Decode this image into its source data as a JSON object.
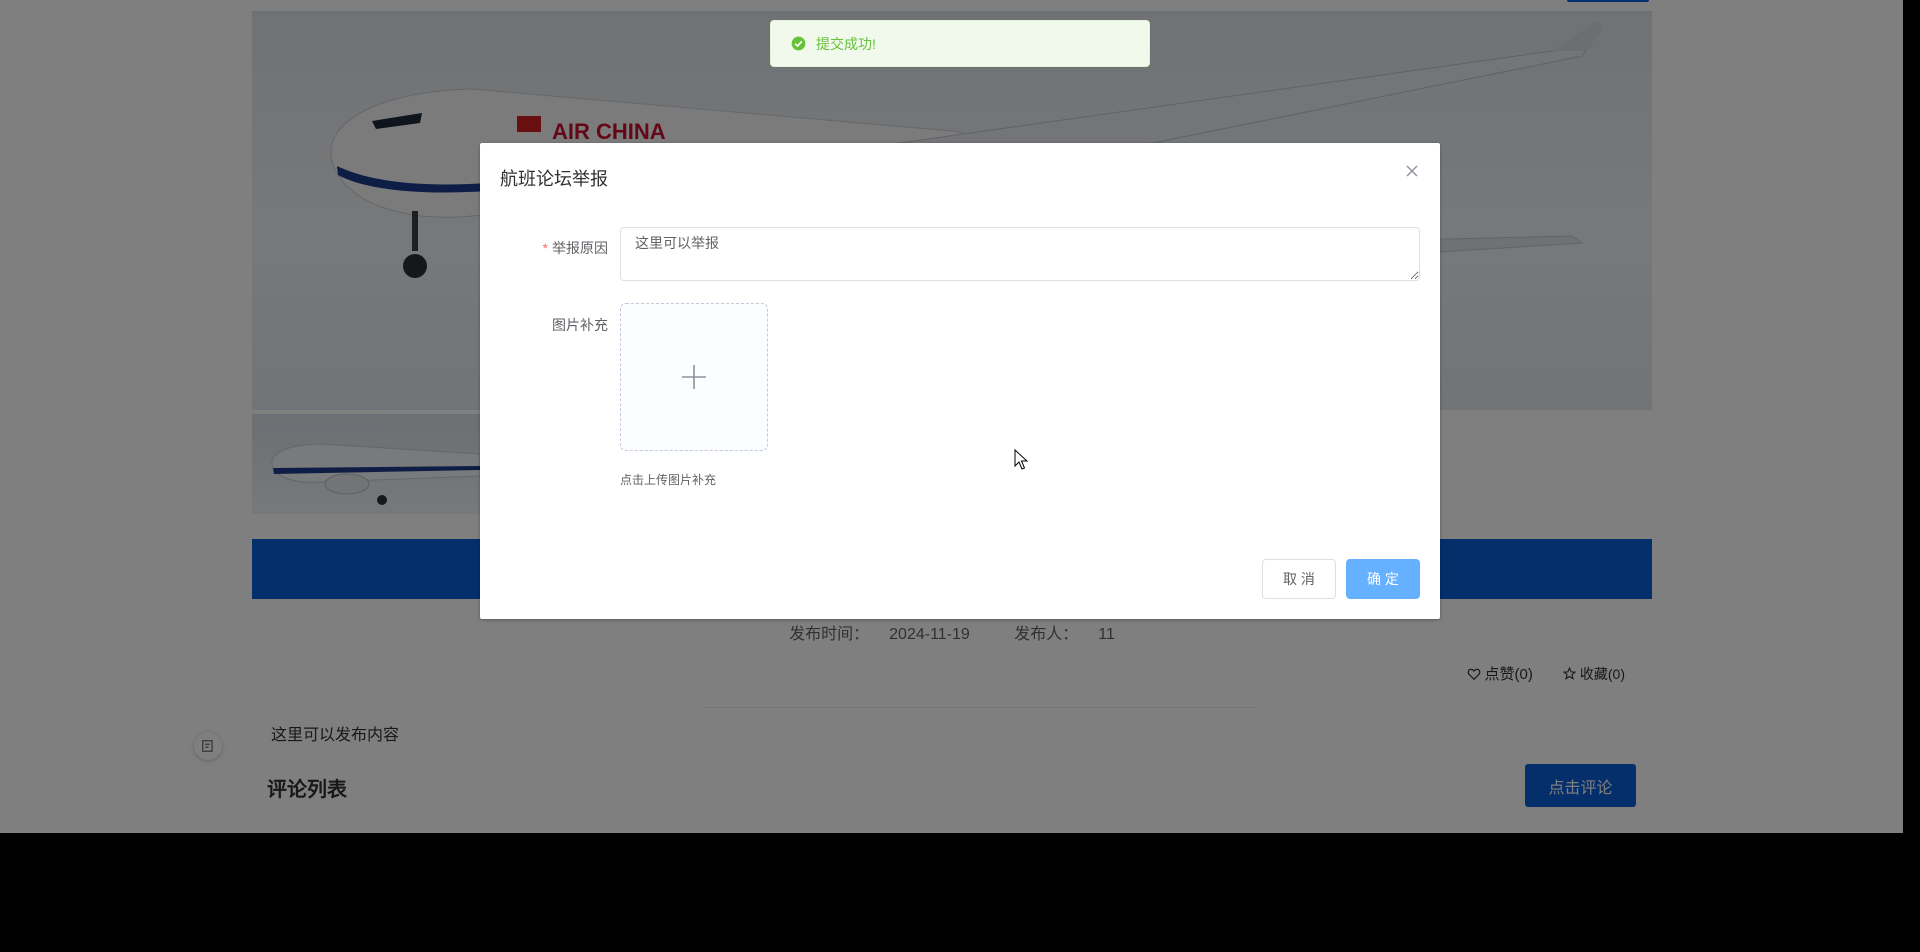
{
  "background": {
    "meta": {
      "time_label": "发布时间：",
      "time_value": "2024-11-19",
      "author_label": "发布人：",
      "author_value": "11"
    },
    "actions": {
      "like_label": "点赞(0)",
      "favorite_label": "收藏(0)"
    },
    "content_text": "这里可以发布内容",
    "comment_title": "评论列表",
    "comment_button": "点击评论",
    "hero_livery_text": "AIR CHINA"
  },
  "toast": {
    "message": "提交成功!",
    "icon": "check-circle-icon",
    "color": "#67c23a"
  },
  "dialog": {
    "title": "航班论坛举报",
    "reason_label": "举报原因",
    "reason_value": "这里可以举报",
    "image_label": "图片补充",
    "upload_tip": "点击上传图片补充",
    "cancel_label": "取 消",
    "confirm_label": "确 定"
  },
  "colors": {
    "primary": "#0a5fd6",
    "confirm": "#66b1ff",
    "required": "#f56c6c"
  }
}
